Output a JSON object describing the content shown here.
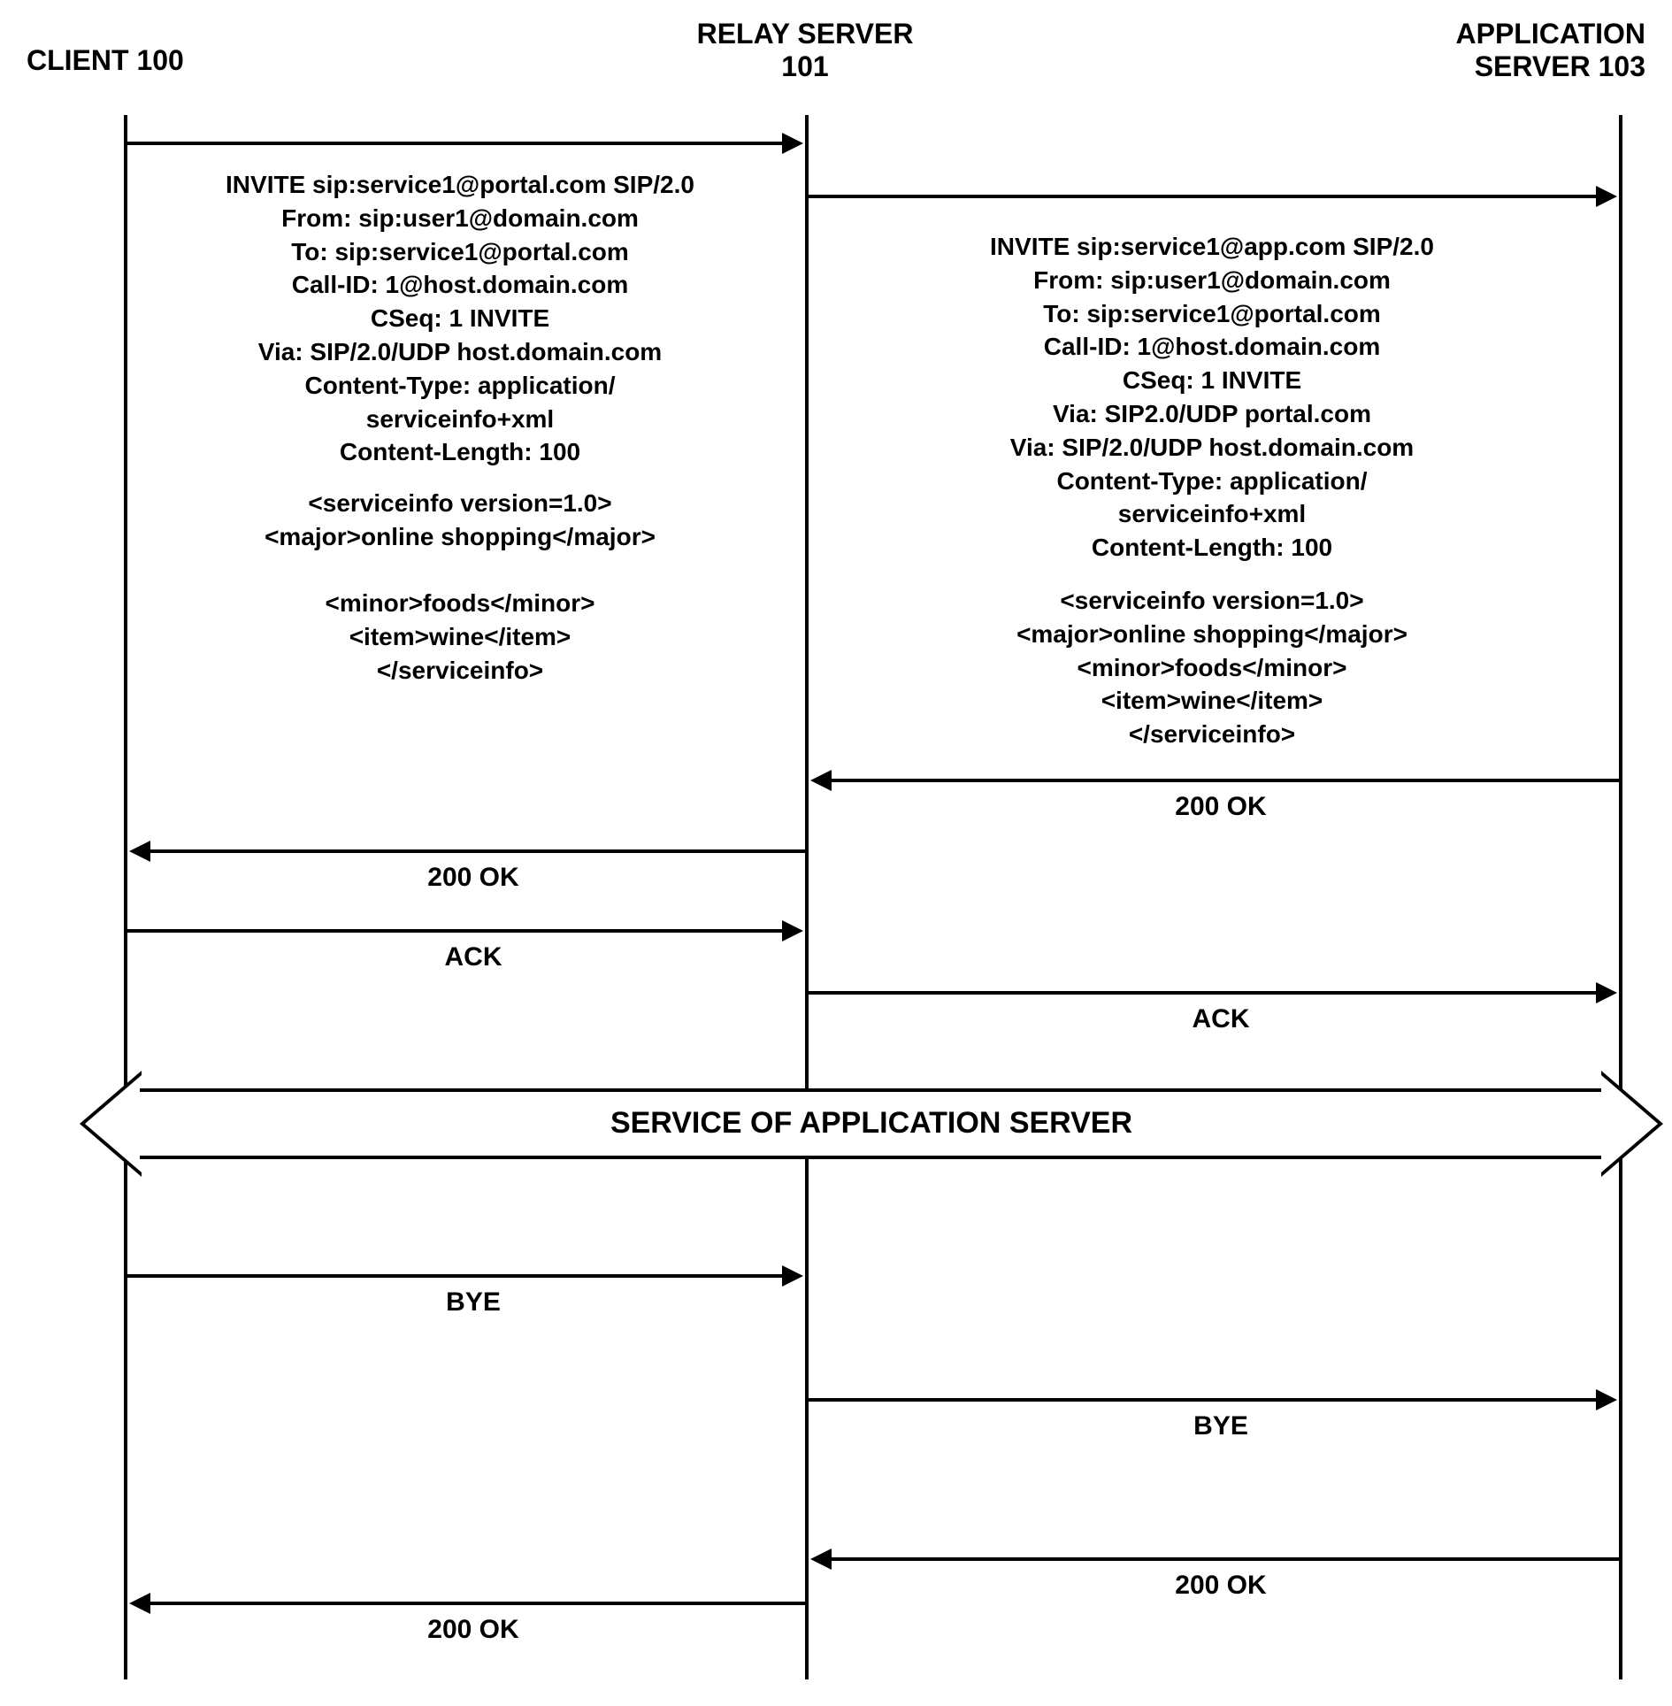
{
  "lifelines": {
    "client": "CLIENT 100",
    "relay": "RELAY SERVER\n101",
    "app": "APPLICATION\nSERVER 103"
  },
  "messages": {
    "invite1_body": "INVITE sip:service1@portal.com SIP/2.0\nFrom: sip:user1@domain.com\nTo: sip:service1@portal.com\nCall-ID: 1@host.domain.com\nCSeq: 1 INVITE\nVia: SIP/2.0/UDP host.domain.com\nContent-Type: application/\nserviceinfo+xml\nContent-Length: 100",
    "invite1_xml": "<serviceinfo version=1.0>\n<major>online shopping</major>\n\n<minor>foods</minor>\n<item>wine</item>\n</serviceinfo>",
    "invite2_body": "INVITE sip:service1@app.com SIP/2.0\nFrom: sip:user1@domain.com\nTo: sip:service1@portal.com\nCall-ID: 1@host.domain.com\nCSeq: 1 INVITE\nVia: SIP2.0/UDP portal.com\nVia: SIP/2.0/UDP host.domain.com\nContent-Type: application/\nserviceinfo+xml\nContent-Length: 100",
    "invite2_xml": "<serviceinfo version=1.0>\n<major>online shopping</major>\n<minor>foods</minor>\n<item>wine</item>\n</serviceinfo>",
    "ok200_ra": "200 OK",
    "ok200_cr": "200 OK",
    "ack_cr": "ACK",
    "ack_ra": "ACK",
    "service": "SERVICE OF APPLICATION SERVER",
    "bye_cr": "BYE",
    "bye_ra": "BYE",
    "ok200_bye_ra": "200 OK",
    "ok200_bye_cr": "200 OK"
  }
}
